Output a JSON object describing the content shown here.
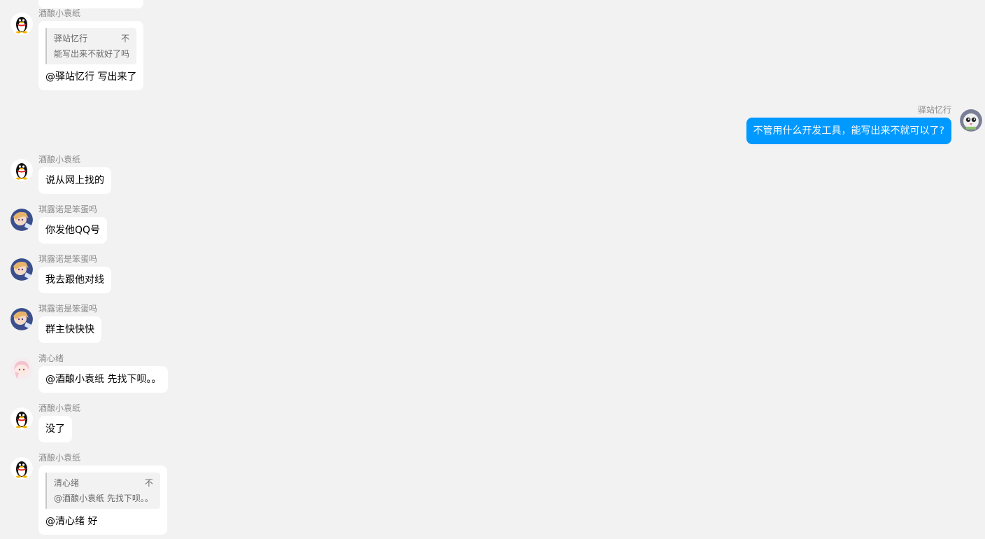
{
  "messages": [
    {
      "side": "left",
      "sender": "酒酿小袁纸",
      "avatar": "qq-penguin-icon",
      "quote": {
        "author": "驿站忆行",
        "mark": "不",
        "text": "能写出来不就好了吗"
      },
      "text": "@驿站忆行 写出来了"
    },
    {
      "side": "right",
      "sender": "驿站忆行",
      "avatar": "cat-avatar-icon",
      "text": "不管用什么开发工具，能写出来不就可以了?"
    },
    {
      "side": "left",
      "sender": "酒酿小袁纸",
      "avatar": "qq-penguin-icon",
      "text": "说从网上找的"
    },
    {
      "side": "left",
      "sender": "琪露诺是笨蛋吗",
      "avatar": "anime-avatar-icon",
      "text": "你发他QQ号"
    },
    {
      "side": "left",
      "sender": "琪露诺是笨蛋吗",
      "avatar": "anime-avatar-icon",
      "text": "我去跟他对线"
    },
    {
      "side": "left",
      "sender": "琪露诺是笨蛋吗",
      "avatar": "anime-avatar-icon",
      "text": "群主快快快"
    },
    {
      "side": "left",
      "sender": "清心绪",
      "avatar": "pink-anime-avatar-icon",
      "text": "@酒酿小袁纸 先找下呗。。"
    },
    {
      "side": "left",
      "sender": "酒酿小袁纸",
      "avatar": "qq-penguin-icon",
      "text": "没了"
    },
    {
      "side": "left",
      "sender": "酒酿小袁纸",
      "avatar": "qq-penguin-icon",
      "quote": {
        "author": "清心绪",
        "mark": "不",
        "text": "@酒酿小袁纸 先找下呗。。"
      },
      "text": "@清心绪 好"
    }
  ]
}
